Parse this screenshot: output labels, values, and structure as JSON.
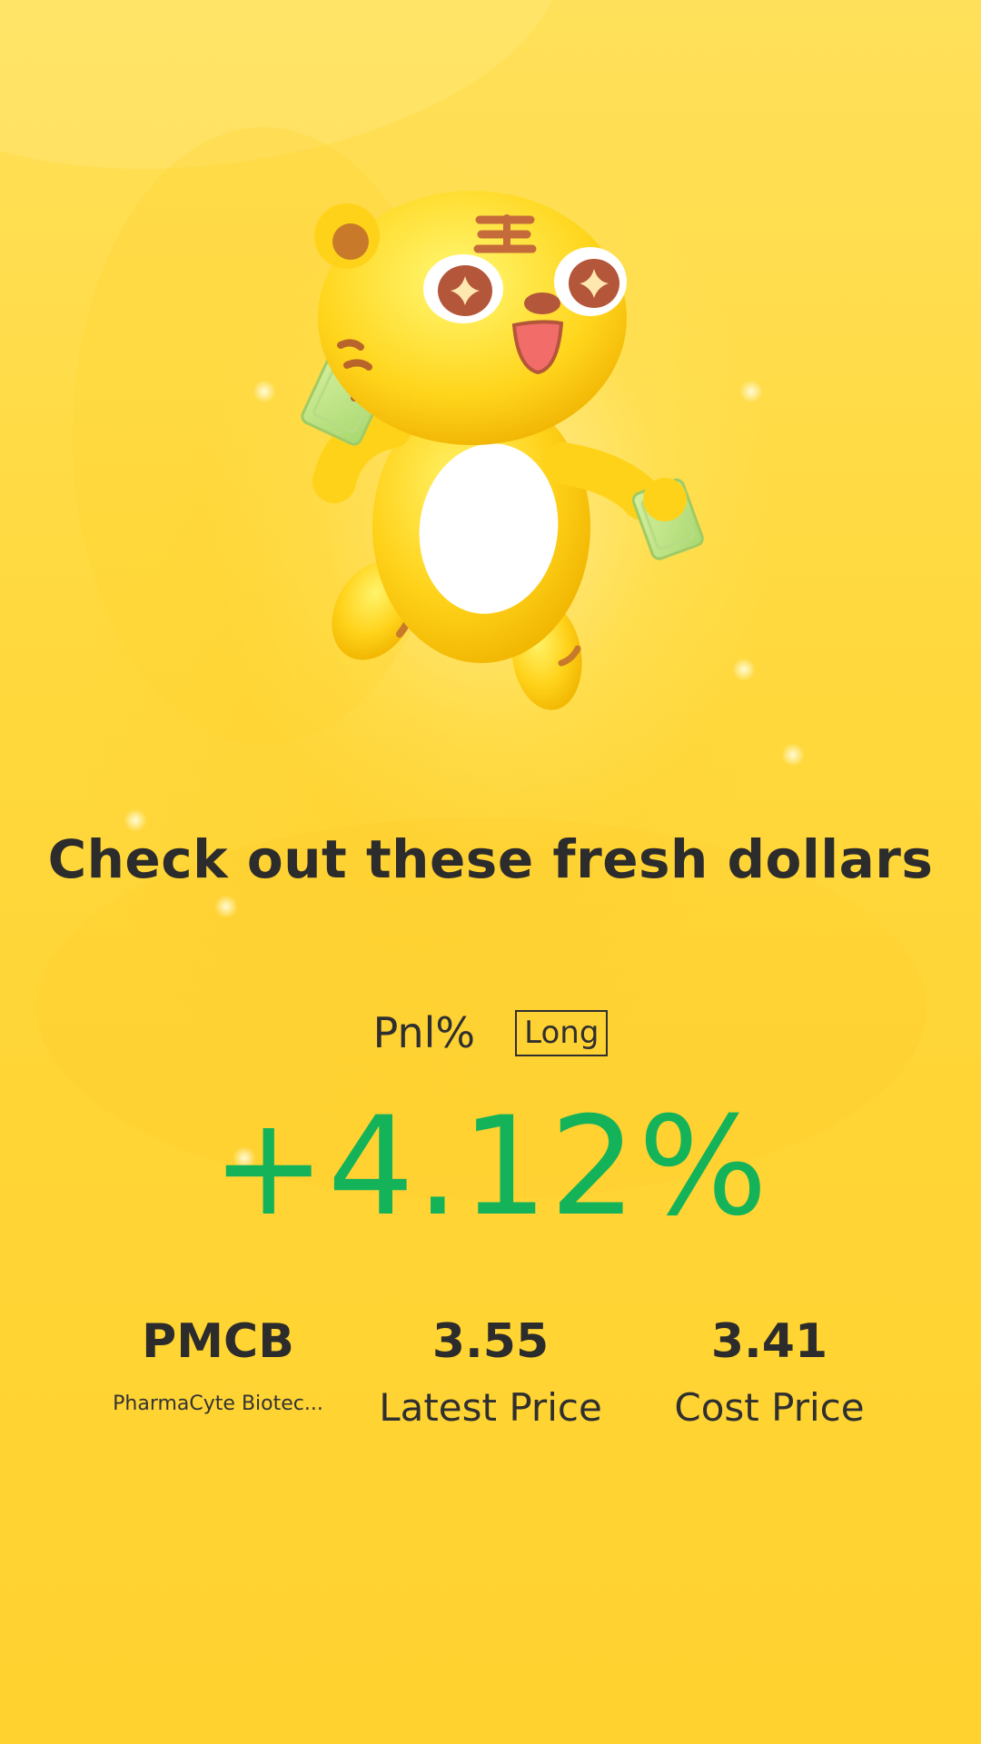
{
  "headline": "Check out these fresh dollars",
  "pnl": {
    "label": "Pnl%",
    "badge": "Long",
    "value": "+4.12%"
  },
  "stock": {
    "ticker": "PMCB",
    "name": "PharmaCyte Biotec..."
  },
  "latest_price": {
    "value": "3.55",
    "label": "Latest Price"
  },
  "cost_price": {
    "value": "3.41",
    "label": "Cost Price"
  },
  "colors": {
    "background": "#ffd93a",
    "profit": "#14b35a",
    "text": "#2c2c2c"
  },
  "icons": {
    "mascot": "tiger-mascot-holding-cash-icon"
  }
}
